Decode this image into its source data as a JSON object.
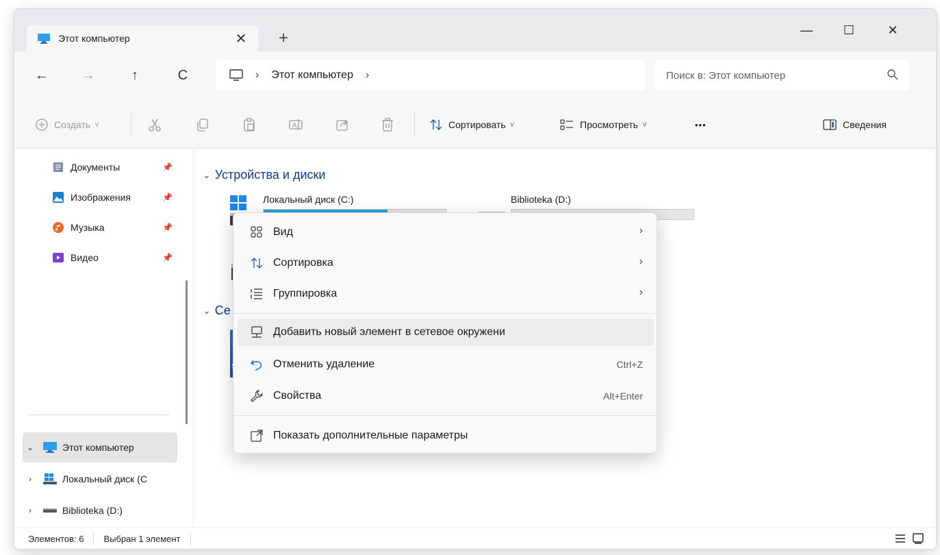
{
  "window": {
    "tab_title": "Этот компьютер",
    "tab_close": "✕",
    "new_tab": "+",
    "minimize": "—",
    "maximize": "☐",
    "close": "✕"
  },
  "nav": {
    "back": "←",
    "forward": "→",
    "up": "↑",
    "refresh": "C",
    "breadcrumb_sep": "›",
    "address_label": "Этот компьютер",
    "address_trailing_sep": "›",
    "search_placeholder": "Поиск в: Этот компьютер"
  },
  "toolbar": {
    "create_label": "Создать",
    "sort_label": "Сортировать",
    "view_label": "Просмотреть",
    "more_label": "•••",
    "details_label": "Сведения",
    "dropdown_chevron": "˅"
  },
  "sidebar": {
    "quick_items": [
      {
        "label": "Документы",
        "icon": "documents-icon"
      },
      {
        "label": "Изображения",
        "icon": "pictures-icon"
      },
      {
        "label": "Музыка",
        "icon": "music-icon"
      },
      {
        "label": "Видео",
        "icon": "videos-icon"
      }
    ],
    "tree": [
      {
        "label": "Этот компьютер",
        "chevron": "⌄"
      },
      {
        "label": "Локальный диск (C",
        "chevron": "›"
      },
      {
        "label": "Biblioteka (D:)",
        "chevron": "›"
      }
    ]
  },
  "content": {
    "section_devices": "Устройства и диски",
    "section_network": "Се",
    "network_item_text": "Sy",
    "drives": [
      {
        "label": "Локальный диск (C:)",
        "usage": 0.68
      },
      {
        "label": "Biblioteka (D:)",
        "usage": 0.0
      }
    ]
  },
  "context_menu": {
    "items": [
      {
        "label": "Вид",
        "icon": "view-icon",
        "arrow": "›",
        "shortcut": ""
      },
      {
        "label": "Сортировка",
        "icon": "sort-icon",
        "arrow": "›",
        "shortcut": ""
      },
      {
        "label": "Группировка",
        "icon": "group-icon",
        "arrow": "›",
        "shortcut": ""
      },
      {
        "label": "Добавить новый элемент в сетевое окружени",
        "icon": "network-location-icon",
        "arrow": "",
        "shortcut": ""
      },
      {
        "label": "Отменить удаление",
        "icon": "undo-icon",
        "arrow": "",
        "shortcut": "Ctrl+Z"
      },
      {
        "label": "Свойства",
        "icon": "properties-icon",
        "arrow": "",
        "shortcut": "Alt+Enter"
      },
      {
        "label": "Показать дополнительные параметры",
        "icon": "more-options-icon",
        "arrow": "",
        "shortcut": ""
      }
    ]
  },
  "status": {
    "count": "Элементов: 6",
    "selected": "Выбран 1 элемент"
  },
  "colors": {
    "accent": "#26a0da",
    "section_title": "#0d3a8c"
  }
}
